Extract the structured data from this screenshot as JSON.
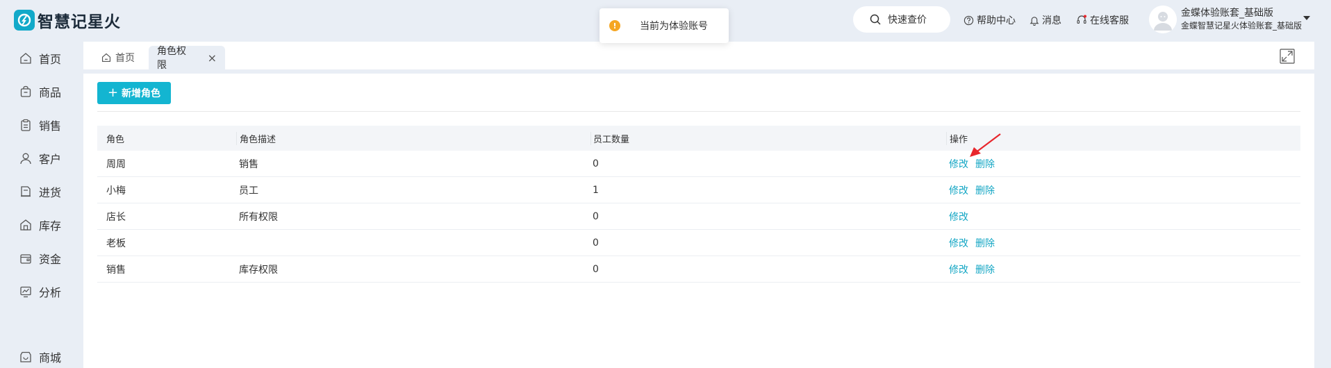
{
  "header": {
    "logo_text": "智慧记星火",
    "search_label": "快速查价",
    "help_label": "帮助中心",
    "message_label": "消息",
    "service_label": "在线客服",
    "notice_text": "当前为体验账号",
    "user_name": "金蝶体验账套_基础版",
    "user_account": "金蝶智慧记星火体验账套_基础版"
  },
  "sidebar": {
    "items": [
      {
        "label": "首页",
        "icon": "home-icon"
      },
      {
        "label": "商品",
        "icon": "box-icon"
      },
      {
        "label": "销售",
        "icon": "clipboard-icon"
      },
      {
        "label": "客户",
        "icon": "user-icon"
      },
      {
        "label": "进货",
        "icon": "purchase-icon"
      },
      {
        "label": "库存",
        "icon": "warehouse-icon"
      },
      {
        "label": "资金",
        "icon": "wallet-icon"
      },
      {
        "label": "分析",
        "icon": "chart-icon"
      },
      {
        "label": "商城",
        "icon": "shop-icon"
      }
    ]
  },
  "tabs": {
    "home": "首页",
    "active": "角色权限"
  },
  "toolbar": {
    "add_role_label": "新增角色"
  },
  "table": {
    "headers": [
      "角色",
      "角色描述",
      "员工数量",
      "操作"
    ],
    "rows": [
      {
        "role": "周周",
        "desc": "销售",
        "count": "0",
        "edit": "修改",
        "delete": "删除"
      },
      {
        "role": "小梅",
        "desc": "员工",
        "count": "1",
        "edit": "修改",
        "delete": "删除"
      },
      {
        "role": "店长",
        "desc": "所有权限",
        "count": "0",
        "edit": "修改",
        "delete": ""
      },
      {
        "role": "老板",
        "desc": "",
        "count": "0",
        "edit": "修改",
        "delete": "删除"
      },
      {
        "role": "销售",
        "desc": "库存权限",
        "count": "0",
        "edit": "修改",
        "delete": "删除"
      }
    ]
  },
  "colors": {
    "accent": "#13b5d1",
    "link": "#13a6c4",
    "background": "#e9eef5",
    "arrow": "#e8262c"
  }
}
